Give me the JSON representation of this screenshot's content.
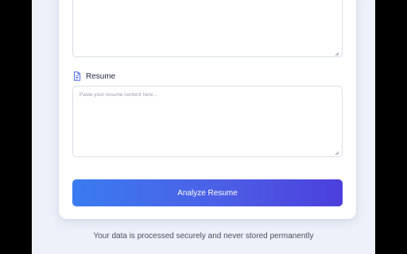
{
  "form": {
    "top_textarea": {
      "value": "",
      "placeholder": ""
    },
    "resume": {
      "label": "Resume",
      "icon": "document-icon",
      "value": "",
      "placeholder": "Paste your resume content here..."
    },
    "submit_label": "Analyze Resume"
  },
  "footer": {
    "note": "Your data is processed securely and never stored permanently"
  },
  "colors": {
    "page_background": "#eef1fa",
    "accent_start": "#3a7bf0",
    "accent_end": "#4b3fdc",
    "label_text": "#1f2a44",
    "icon": "#4a6cf0"
  }
}
